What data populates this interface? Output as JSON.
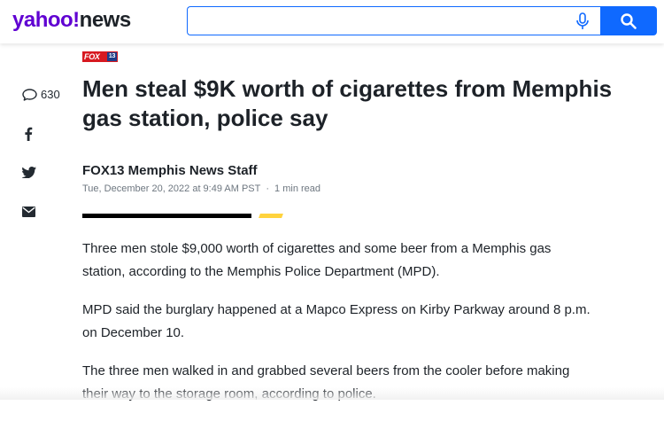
{
  "header": {
    "logo_yahoo": "yahoo!",
    "logo_news": "news",
    "search_placeholder": "",
    "search_value": ""
  },
  "article": {
    "source_logo": "FOX13",
    "source_logo_main": "FOX",
    "source_logo_num": "13",
    "headline": "Men steal $9K worth of cigarettes from Memphis gas station, police say",
    "author": "FOX13 Memphis News Staff",
    "date": "Tue, December 20, 2022 at 9:49 AM PST",
    "separator": "·",
    "read_time": "1 min read",
    "paragraphs": [
      "Three men stole $9,000 worth of cigarettes and some beer from a Memphis gas station, according to the Memphis Police Department (MPD).",
      "MPD said the burglary happened at a Mapco Express on Kirby Parkway around 8 p.m. on December 10.",
      "The three men walked in and grabbed several beers from the cooler before making their way to the storage room, according to police."
    ]
  },
  "share_rail": {
    "comment_count": "630",
    "icons": [
      "comment-icon",
      "facebook-icon",
      "twitter-icon",
      "mail-icon"
    ]
  },
  "colors": {
    "brand_purple": "#6001d2",
    "search_blue": "#0f69ff",
    "accent_yellow": "#ffd33d",
    "text_dark": "#1d2228",
    "meta_gray": "#6e7780"
  }
}
